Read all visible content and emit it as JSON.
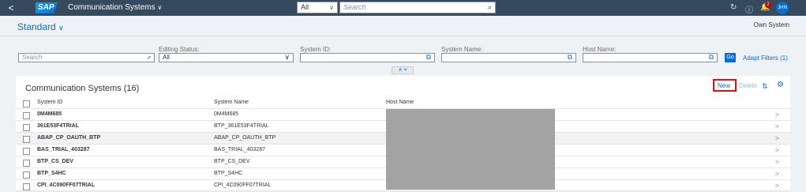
{
  "shell": {
    "back_icon": "<",
    "logo": "SAP",
    "title": "Communication Systems",
    "title_chevron": "∨",
    "scope": "All",
    "search_placeholder": "Search",
    "icons": [
      "sync-icon",
      "help-icon",
      "bell-icon"
    ],
    "notification_count": "2",
    "user_initials": "JHN"
  },
  "variant": {
    "label": "Standard",
    "chevron": "∨",
    "own_system": "Own System"
  },
  "filter_bar": {
    "search_placeholder": "Search",
    "editing_status_label": "Editing Status:",
    "editing_status_value": "All",
    "system_id_label": "System ID:",
    "system_name_label": "System Name:",
    "host_name_label": "Host Name:",
    "go_label": "Go",
    "adapt_filters_label": "Adapt Filters (1)"
  },
  "table": {
    "title": "Communication Systems (16)",
    "new_label": "New",
    "delete_label": "Delete",
    "columns": [
      "System ID",
      "System Name",
      "Host Name"
    ],
    "rows": [
      {
        "id": "0M4M685",
        "name": "0M4M685"
      },
      {
        "id": "361E53F4TRIAL",
        "name": "BTP_361E53F4TRIAL"
      },
      {
        "id": "ABAP_CP_OAUTH_BTP",
        "name": "ABAP_CP_OAUTH_BTP"
      },
      {
        "id": "BAS_TRIAL_403287",
        "name": "BAS_TRIAL_403287"
      },
      {
        "id": "BTP_CS_DEV",
        "name": "BTP_CS_DEV"
      },
      {
        "id": "BTP_S4HC",
        "name": "BTP_S4HC"
      },
      {
        "id": "CPI_4C090FF07TRIAL",
        "name": "CPI_4C090FF07TRIAL"
      }
    ],
    "selected_row": 2
  },
  "colors": {
    "shell": "#354a5f",
    "accent": "#0a6ed1",
    "highlight": "#e01010"
  }
}
